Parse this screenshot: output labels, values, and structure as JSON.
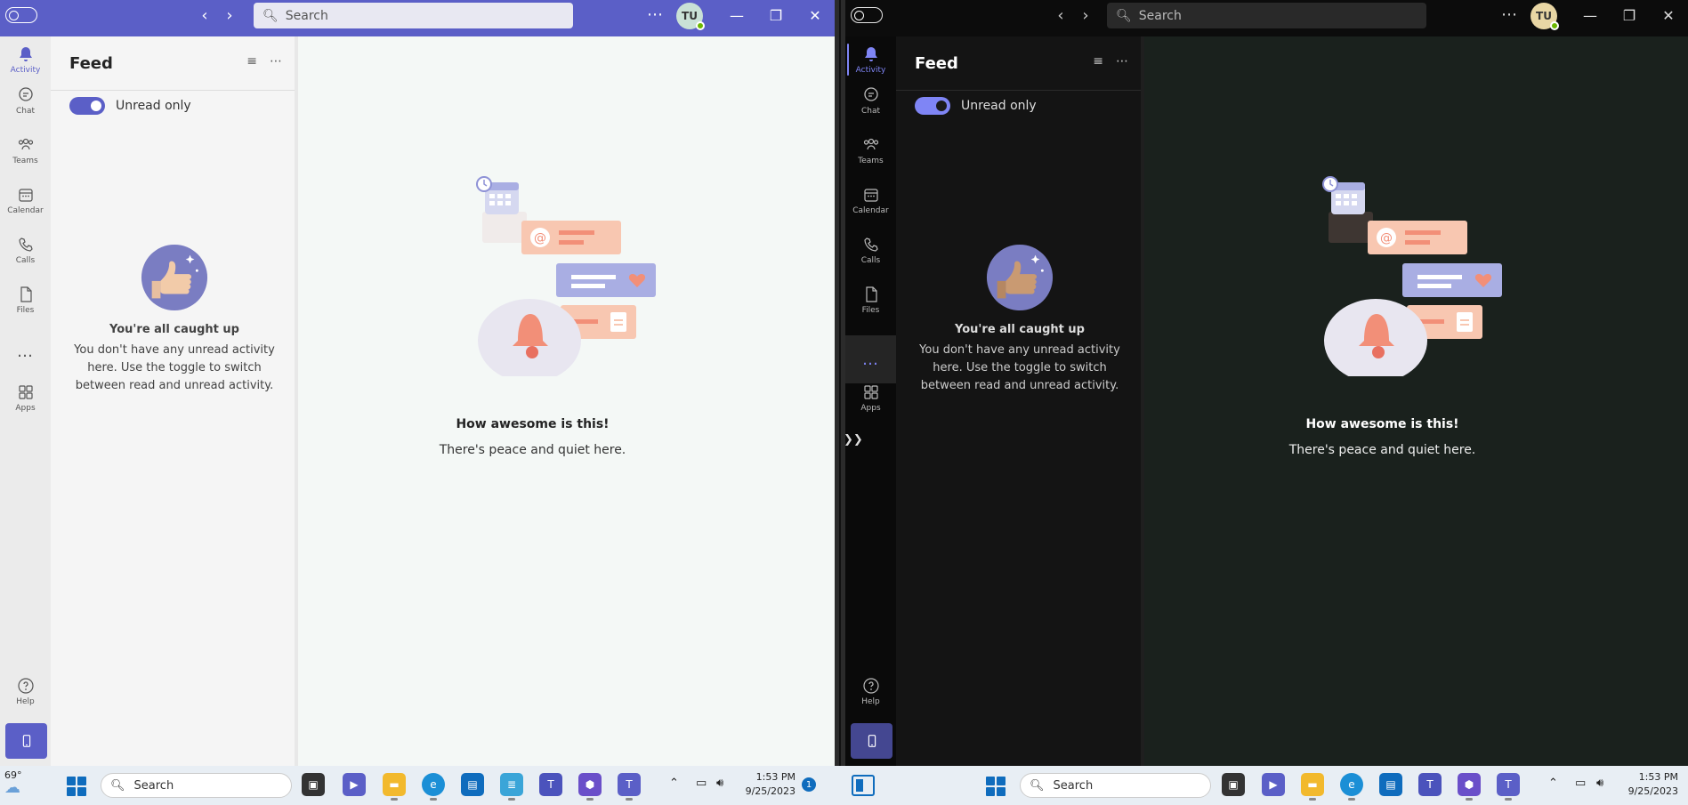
{
  "titlebar": {
    "search_placeholder": "Search",
    "avatar_initials": "TU",
    "more": "⋯"
  },
  "rail": {
    "items": [
      {
        "label": "Activity",
        "icon": "bell-icon"
      },
      {
        "label": "Chat",
        "icon": "chat-icon"
      },
      {
        "label": "Teams",
        "icon": "teams-icon"
      },
      {
        "label": "Calendar",
        "icon": "calendar-icon"
      },
      {
        "label": "Calls",
        "icon": "phone-icon"
      },
      {
        "label": "Files",
        "icon": "file-icon"
      },
      {
        "label": "Apps",
        "icon": "apps-icon"
      },
      {
        "label": "Help",
        "icon": "help-icon"
      }
    ],
    "more": "…"
  },
  "feed": {
    "title": "Feed",
    "toggle_label": "Unread only",
    "empty_title": "You're all caught up",
    "empty_desc": "You don't have any unread activity here. Use the toggle to switch between read and unread activity."
  },
  "main": {
    "title": "How awesome is this!",
    "subtitle": "There's peace and quiet here."
  },
  "taskbar": {
    "weather_temp": "69°",
    "search_label": "Search",
    "time": "1:53 PM",
    "date": "9/25/2023",
    "notification_count": "1"
  },
  "colors": {
    "brand": "#5b5fc7",
    "brand_dark": "#7f85f5",
    "presence": "#6bb700"
  }
}
